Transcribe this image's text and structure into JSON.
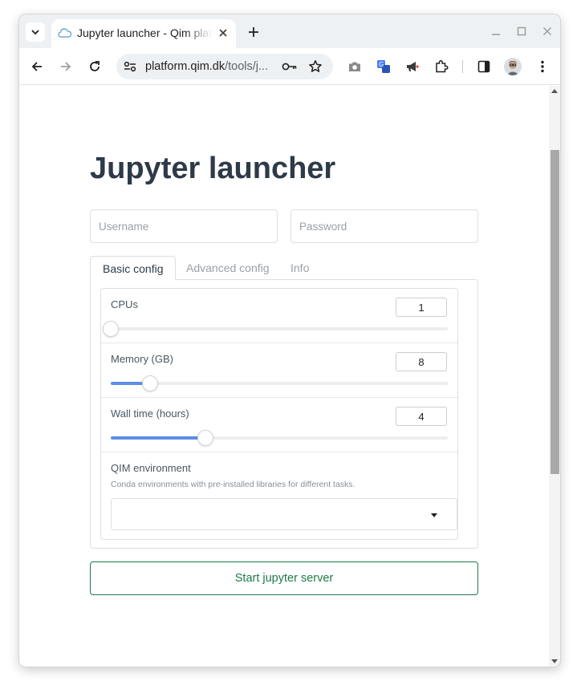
{
  "browser": {
    "tab_title": "Jupyter launcher - Qim platform",
    "url_host": "platform.qim.dk",
    "url_path": "/tools/j..."
  },
  "page": {
    "title": "Jupyter launcher",
    "username_placeholder": "Username",
    "password_placeholder": "Password",
    "tabs": [
      {
        "label": "Basic config",
        "active": true
      },
      {
        "label": "Advanced config",
        "active": false
      },
      {
        "label": "Info",
        "active": false
      }
    ],
    "cpus": {
      "label": "CPUs",
      "value": "1",
      "fill_fraction": 0.0
    },
    "memory": {
      "label": "Memory (GB)",
      "value": "8",
      "fill_fraction": 0.117
    },
    "walltime": {
      "label": "Wall time (hours)",
      "value": "4",
      "fill_fraction": 0.282
    },
    "environment": {
      "label": "QIM environment",
      "description": "Conda environments with pre-installed libraries for different tasks.",
      "selected": ""
    },
    "start_button": "Start jupyter server"
  },
  "colors": {
    "accent_green": "#1d7a4a",
    "slider_fill": "#5d8ee8",
    "title_color": "#2e3a48"
  }
}
